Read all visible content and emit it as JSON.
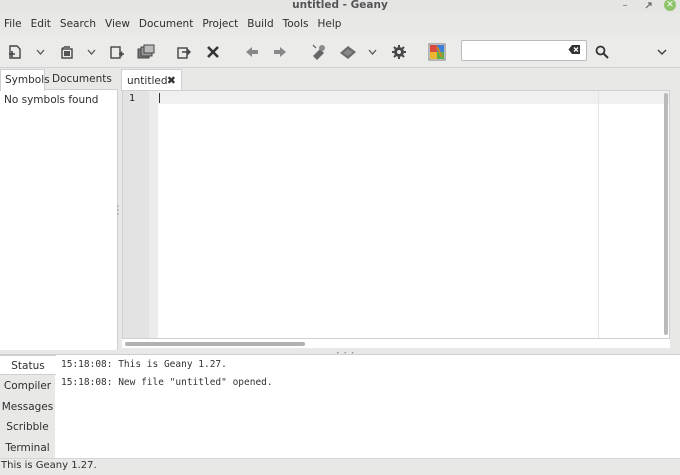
{
  "window": {
    "title": "untitled - Geany",
    "controls": [
      "minimize-icon",
      "restore-icon",
      "close-icon"
    ]
  },
  "menu": {
    "items": [
      "File",
      "Edit",
      "Search",
      "View",
      "Document",
      "Project",
      "Build",
      "Tools",
      "Help"
    ]
  },
  "toolbar": {
    "buttons": [
      "new-file-icon",
      "new-from-template-arrow",
      "open-file-icon",
      "recent-files-arrow",
      "save-icon",
      "save-all-icon",
      "revert-icon",
      "close-file-icon",
      "navigate-back-icon",
      "navigate-forward-icon",
      "compile-icon",
      "build-icon",
      "build-options-arrow",
      "run-settings-icon",
      "color-chooser-icon",
      "find-icon",
      "overflow-chevron-icon"
    ],
    "search": {
      "value": "",
      "placeholder": ""
    }
  },
  "sidebar": {
    "tabs": [
      "Symbols",
      "Documents"
    ],
    "active_tab": "Symbols",
    "empty_message": "No symbols found"
  },
  "editor": {
    "tabs": [
      {
        "label": "untitled",
        "close": "✖"
      }
    ],
    "line_numbers": [
      "1"
    ],
    "content": ""
  },
  "messages": {
    "tabs": [
      "Status",
      "Compiler",
      "Messages",
      "Scribble",
      "Terminal"
    ],
    "active_tab": "Status",
    "lines": [
      "15:18:08: This is Geany 1.27.",
      "15:18:08: New file \"untitled\" opened."
    ]
  },
  "statusbar": {
    "text": "This is Geany 1.27."
  },
  "colors": {
    "window_bg": "#e8e8e7",
    "editor_bg": "#ffffff",
    "gutter_bg": "#e3e3e3",
    "close_button": "#8fc46a"
  }
}
